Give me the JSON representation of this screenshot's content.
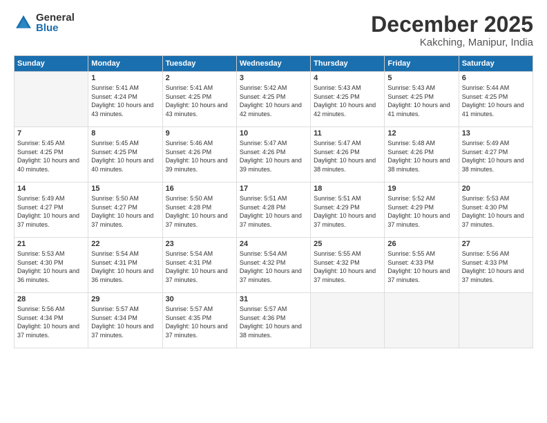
{
  "logo": {
    "general": "General",
    "blue": "Blue"
  },
  "title": "December 2025",
  "subtitle": "Kakching, Manipur, India",
  "headers": [
    "Sunday",
    "Monday",
    "Tuesday",
    "Wednesday",
    "Thursday",
    "Friday",
    "Saturday"
  ],
  "weeks": [
    [
      {
        "num": "",
        "sunrise": "",
        "sunset": "",
        "daylight": ""
      },
      {
        "num": "1",
        "sunrise": "Sunrise: 5:41 AM",
        "sunset": "Sunset: 4:24 PM",
        "daylight": "Daylight: 10 hours and 43 minutes."
      },
      {
        "num": "2",
        "sunrise": "Sunrise: 5:41 AM",
        "sunset": "Sunset: 4:25 PM",
        "daylight": "Daylight: 10 hours and 43 minutes."
      },
      {
        "num": "3",
        "sunrise": "Sunrise: 5:42 AM",
        "sunset": "Sunset: 4:25 PM",
        "daylight": "Daylight: 10 hours and 42 minutes."
      },
      {
        "num": "4",
        "sunrise": "Sunrise: 5:43 AM",
        "sunset": "Sunset: 4:25 PM",
        "daylight": "Daylight: 10 hours and 42 minutes."
      },
      {
        "num": "5",
        "sunrise": "Sunrise: 5:43 AM",
        "sunset": "Sunset: 4:25 PM",
        "daylight": "Daylight: 10 hours and 41 minutes."
      },
      {
        "num": "6",
        "sunrise": "Sunrise: 5:44 AM",
        "sunset": "Sunset: 4:25 PM",
        "daylight": "Daylight: 10 hours and 41 minutes."
      }
    ],
    [
      {
        "num": "7",
        "sunrise": "Sunrise: 5:45 AM",
        "sunset": "Sunset: 4:25 PM",
        "daylight": "Daylight: 10 hours and 40 minutes."
      },
      {
        "num": "8",
        "sunrise": "Sunrise: 5:45 AM",
        "sunset": "Sunset: 4:25 PM",
        "daylight": "Daylight: 10 hours and 40 minutes."
      },
      {
        "num": "9",
        "sunrise": "Sunrise: 5:46 AM",
        "sunset": "Sunset: 4:26 PM",
        "daylight": "Daylight: 10 hours and 39 minutes."
      },
      {
        "num": "10",
        "sunrise": "Sunrise: 5:47 AM",
        "sunset": "Sunset: 4:26 PM",
        "daylight": "Daylight: 10 hours and 39 minutes."
      },
      {
        "num": "11",
        "sunrise": "Sunrise: 5:47 AM",
        "sunset": "Sunset: 4:26 PM",
        "daylight": "Daylight: 10 hours and 38 minutes."
      },
      {
        "num": "12",
        "sunrise": "Sunrise: 5:48 AM",
        "sunset": "Sunset: 4:26 PM",
        "daylight": "Daylight: 10 hours and 38 minutes."
      },
      {
        "num": "13",
        "sunrise": "Sunrise: 5:49 AM",
        "sunset": "Sunset: 4:27 PM",
        "daylight": "Daylight: 10 hours and 38 minutes."
      }
    ],
    [
      {
        "num": "14",
        "sunrise": "Sunrise: 5:49 AM",
        "sunset": "Sunset: 4:27 PM",
        "daylight": "Daylight: 10 hours and 37 minutes."
      },
      {
        "num": "15",
        "sunrise": "Sunrise: 5:50 AM",
        "sunset": "Sunset: 4:27 PM",
        "daylight": "Daylight: 10 hours and 37 minutes."
      },
      {
        "num": "16",
        "sunrise": "Sunrise: 5:50 AM",
        "sunset": "Sunset: 4:28 PM",
        "daylight": "Daylight: 10 hours and 37 minutes."
      },
      {
        "num": "17",
        "sunrise": "Sunrise: 5:51 AM",
        "sunset": "Sunset: 4:28 PM",
        "daylight": "Daylight: 10 hours and 37 minutes."
      },
      {
        "num": "18",
        "sunrise": "Sunrise: 5:51 AM",
        "sunset": "Sunset: 4:29 PM",
        "daylight": "Daylight: 10 hours and 37 minutes."
      },
      {
        "num": "19",
        "sunrise": "Sunrise: 5:52 AM",
        "sunset": "Sunset: 4:29 PM",
        "daylight": "Daylight: 10 hours and 37 minutes."
      },
      {
        "num": "20",
        "sunrise": "Sunrise: 5:53 AM",
        "sunset": "Sunset: 4:30 PM",
        "daylight": "Daylight: 10 hours and 37 minutes."
      }
    ],
    [
      {
        "num": "21",
        "sunrise": "Sunrise: 5:53 AM",
        "sunset": "Sunset: 4:30 PM",
        "daylight": "Daylight: 10 hours and 36 minutes."
      },
      {
        "num": "22",
        "sunrise": "Sunrise: 5:54 AM",
        "sunset": "Sunset: 4:31 PM",
        "daylight": "Daylight: 10 hours and 36 minutes."
      },
      {
        "num": "23",
        "sunrise": "Sunrise: 5:54 AM",
        "sunset": "Sunset: 4:31 PM",
        "daylight": "Daylight: 10 hours and 37 minutes."
      },
      {
        "num": "24",
        "sunrise": "Sunrise: 5:54 AM",
        "sunset": "Sunset: 4:32 PM",
        "daylight": "Daylight: 10 hours and 37 minutes."
      },
      {
        "num": "25",
        "sunrise": "Sunrise: 5:55 AM",
        "sunset": "Sunset: 4:32 PM",
        "daylight": "Daylight: 10 hours and 37 minutes."
      },
      {
        "num": "26",
        "sunrise": "Sunrise: 5:55 AM",
        "sunset": "Sunset: 4:33 PM",
        "daylight": "Daylight: 10 hours and 37 minutes."
      },
      {
        "num": "27",
        "sunrise": "Sunrise: 5:56 AM",
        "sunset": "Sunset: 4:33 PM",
        "daylight": "Daylight: 10 hours and 37 minutes."
      }
    ],
    [
      {
        "num": "28",
        "sunrise": "Sunrise: 5:56 AM",
        "sunset": "Sunset: 4:34 PM",
        "daylight": "Daylight: 10 hours and 37 minutes."
      },
      {
        "num": "29",
        "sunrise": "Sunrise: 5:57 AM",
        "sunset": "Sunset: 4:34 PM",
        "daylight": "Daylight: 10 hours and 37 minutes."
      },
      {
        "num": "30",
        "sunrise": "Sunrise: 5:57 AM",
        "sunset": "Sunset: 4:35 PM",
        "daylight": "Daylight: 10 hours and 37 minutes."
      },
      {
        "num": "31",
        "sunrise": "Sunrise: 5:57 AM",
        "sunset": "Sunset: 4:36 PM",
        "daylight": "Daylight: 10 hours and 38 minutes."
      },
      {
        "num": "",
        "sunrise": "",
        "sunset": "",
        "daylight": ""
      },
      {
        "num": "",
        "sunrise": "",
        "sunset": "",
        "daylight": ""
      },
      {
        "num": "",
        "sunrise": "",
        "sunset": "",
        "daylight": ""
      }
    ]
  ]
}
